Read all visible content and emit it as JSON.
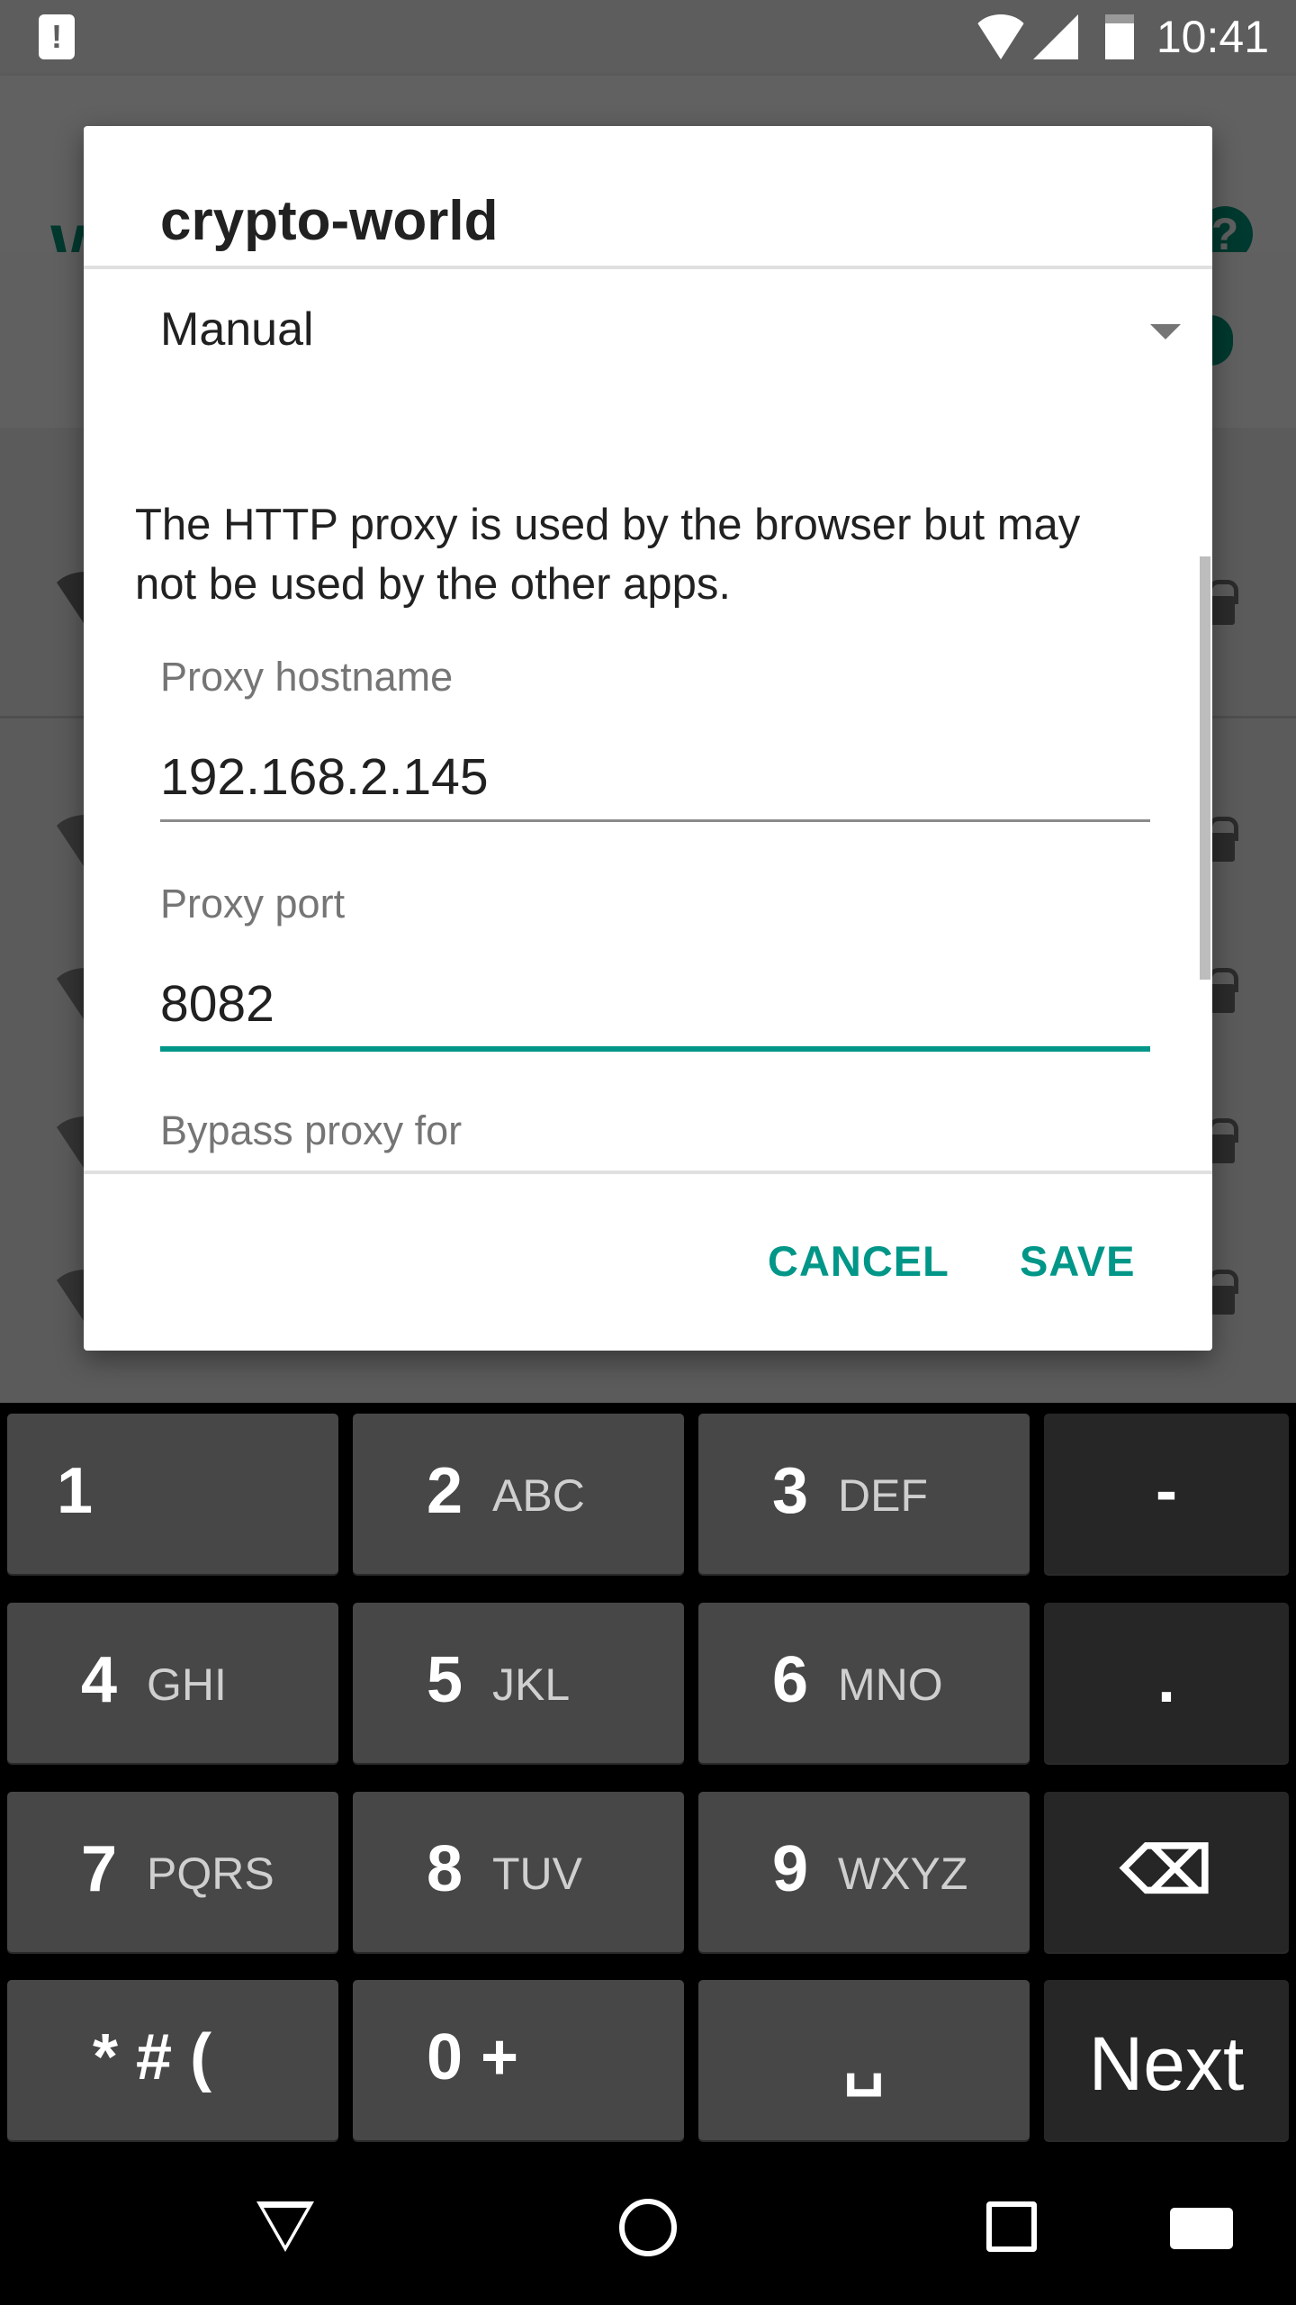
{
  "status_bar": {
    "time": "10:41",
    "icons": [
      "alert-icon",
      "wifi-icon",
      "signal-icon",
      "battery-charging-icon"
    ]
  },
  "background": {
    "title_fragment": "W",
    "help_icon": "?"
  },
  "dialog": {
    "title": "crypto-world",
    "proxy_mode": "Manual",
    "description": "The HTTP proxy is used by the browser but may not be used by the other apps.",
    "hostname_label": "Proxy hostname",
    "hostname_value": "192.168.2.145",
    "port_label": "Proxy port",
    "port_value": "8082",
    "bypass_label": "Bypass proxy for",
    "cancel": "CANCEL",
    "save": "SAVE"
  },
  "colors": {
    "accent": "#009688",
    "keyboard_key": "#474747",
    "keyboard_func_key": "#262626"
  },
  "keyboard": {
    "keys": [
      {
        "n": "1",
        "s": ""
      },
      {
        "n": "2",
        "s": "ABC"
      },
      {
        "n": "3",
        "s": "DEF"
      },
      {
        "n": "-",
        "s": ""
      },
      {
        "n": "4",
        "s": "GHI"
      },
      {
        "n": "5",
        "s": "JKL"
      },
      {
        "n": "6",
        "s": "MNO"
      },
      {
        "n": ".",
        "s": ""
      },
      {
        "n": "7",
        "s": "PQRS"
      },
      {
        "n": "8",
        "s": "TUV"
      },
      {
        "n": "9",
        "s": "WXYZ"
      },
      {
        "n": "⌫",
        "s": ""
      },
      {
        "n": "* # (",
        "s": ""
      },
      {
        "n": "0 +",
        "s": ""
      },
      {
        "n": "␣",
        "s": ""
      },
      {
        "n": "Next",
        "s": ""
      }
    ]
  },
  "nav": {
    "icons": [
      "back-icon",
      "home-icon",
      "recents-icon",
      "keyboard-switch-icon"
    ]
  }
}
